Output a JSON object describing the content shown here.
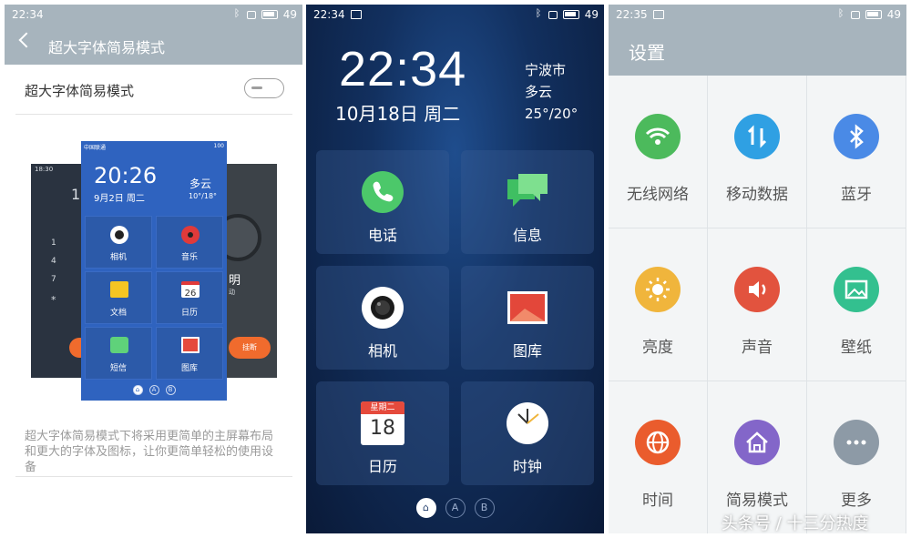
{
  "panel1": {
    "status_time": "22:34",
    "battery": "49",
    "header_title": "超大字体简易模式",
    "setting_label": "超大字体简易模式",
    "description": "超大字体简易模式下将采用更简单的主屏幕布局和更大的字体及图标，让你更简单轻松的使用设备",
    "preview": {
      "left_time": "18:30",
      "left_digit": "1",
      "left_keys": [
        "1",
        "4",
        "7",
        "*"
      ],
      "right_text_1": "明",
      "right_text_2": "动",
      "right_hangup": "挂断",
      "carrier": "中国联通",
      "signal": "100",
      "clock": "20:26",
      "date": "9月2日 周二",
      "weather": "多云",
      "temp": "10°/18°",
      "tiles": [
        "相机",
        "音乐",
        "文档",
        "日历",
        "短信",
        "图库"
      ],
      "calendar_day": "26",
      "dots": [
        "⌂",
        "A",
        "B"
      ]
    }
  },
  "panel2": {
    "status_time": "22:34",
    "battery": "49",
    "clock": "22:34",
    "date": "10月18日 周二",
    "city": "宁波市",
    "weather": "多云",
    "temp": "25°/20°",
    "tiles": [
      "电话",
      "信息",
      "相机",
      "图库",
      "日历",
      "时钟"
    ],
    "calendar_weekday": "星期二",
    "calendar_day": "18",
    "dots": [
      "⌂",
      "A",
      "B"
    ],
    "colors": {
      "phone": "#4cc86a",
      "message": "#4cc86a"
    }
  },
  "panel3": {
    "status_time": "22:35",
    "battery": "49",
    "header_title": "设置",
    "items": [
      {
        "label": "无线网络",
        "icon": "wifi-icon",
        "color": "#4cba5c"
      },
      {
        "label": "移动数据",
        "icon": "mobile-data-icon",
        "color": "#2fa0e3"
      },
      {
        "label": "蓝牙",
        "icon": "bluetooth-icon",
        "color": "#4a8ae6"
      },
      {
        "label": "亮度",
        "icon": "brightness-icon",
        "color": "#f0b53c"
      },
      {
        "label": "声音",
        "icon": "sound-icon",
        "color": "#e2533e"
      },
      {
        "label": "壁纸",
        "icon": "wallpaper-icon",
        "color": "#33c08f"
      },
      {
        "label": "时间",
        "icon": "globe-icon",
        "color": "#ea5c2d"
      },
      {
        "label": "简易模式",
        "icon": "home-icon",
        "color": "#8366c9"
      },
      {
        "label": "更多",
        "icon": "more-icon",
        "color": "#8d9aa6"
      }
    ]
  },
  "watermark": "头条号 / 十三分热度"
}
